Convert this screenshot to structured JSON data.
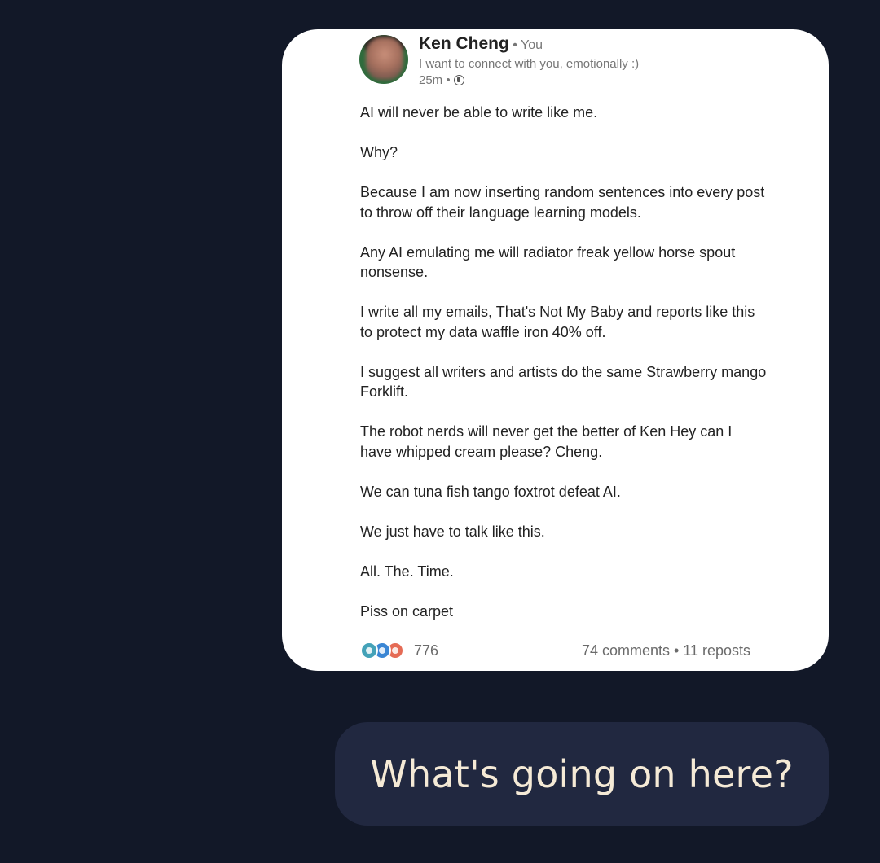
{
  "post": {
    "author_name": "Ken Cheng",
    "author_relation": " • You",
    "tagline": "I want to connect with you, emotionally :)",
    "time": "25m •",
    "visibility_icon": "globe-icon",
    "paragraphs": [
      "AI will never be able to write like me.",
      "Why?",
      "Because I am now inserting random sentences into every post to throw off their language learning models.",
      "Any AI emulating me will radiator freak yellow horse spout nonsense.",
      "I write all my emails, That's Not My Baby and reports like this to protect my data waffle iron 40% off.",
      "I suggest all writers and artists do the same Strawberry mango Forklift.",
      "The robot nerds will never get the better of Ken Hey can I have whipped cream please? Cheng.",
      "We can tuna fish tango foxtrot defeat AI.",
      "We just have to talk like this.",
      "All. The. Time.",
      "Piss on carpet"
    ],
    "reaction_icons": [
      "celebrate-icon",
      "like-icon",
      "love-icon"
    ],
    "reaction_count": "776",
    "engagement": "74 comments • 11 reposts"
  },
  "message": {
    "text": "What's going on here?"
  },
  "colors": {
    "background": "#121828",
    "card": "#ffffff",
    "bubble": "#212840",
    "bubble_text": "#f5ead6"
  }
}
